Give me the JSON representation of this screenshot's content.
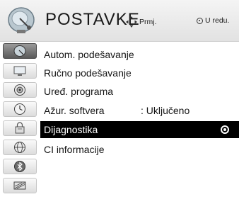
{
  "header": {
    "title": "POSTAVKE",
    "hint_move": "Prmj.",
    "hint_ok": "U redu.",
    "icon": "satellite-dish-icon"
  },
  "sidebar": {
    "items": [
      {
        "icon": "satellite-dish-icon",
        "active": true
      },
      {
        "icon": "tv-picture-icon",
        "active": false
      },
      {
        "icon": "speaker-audio-icon",
        "active": false
      },
      {
        "icon": "clock-icon",
        "active": false
      },
      {
        "icon": "lock-icon",
        "active": false
      },
      {
        "icon": "globe-language-icon",
        "active": false
      },
      {
        "icon": "bluetooth-icon",
        "active": false
      },
      {
        "icon": "input-film-icon",
        "active": false
      }
    ]
  },
  "menu": {
    "items": [
      {
        "label": "Autom. podešavanje",
        "value": ""
      },
      {
        "label": "Ručno podešavanje",
        "value": ""
      },
      {
        "label": "Uređ. programa",
        "value": ""
      },
      {
        "label": "Ažur. softvera",
        "value": ": Uključeno"
      },
      {
        "label": "Dijagnostika",
        "value": "",
        "selected": true
      },
      {
        "label": "CI informacije",
        "value": ""
      }
    ]
  },
  "colors": {
    "selected_bg": "#000000",
    "selected_fg": "#ffffff",
    "header_bg": "#e8e8e8"
  }
}
